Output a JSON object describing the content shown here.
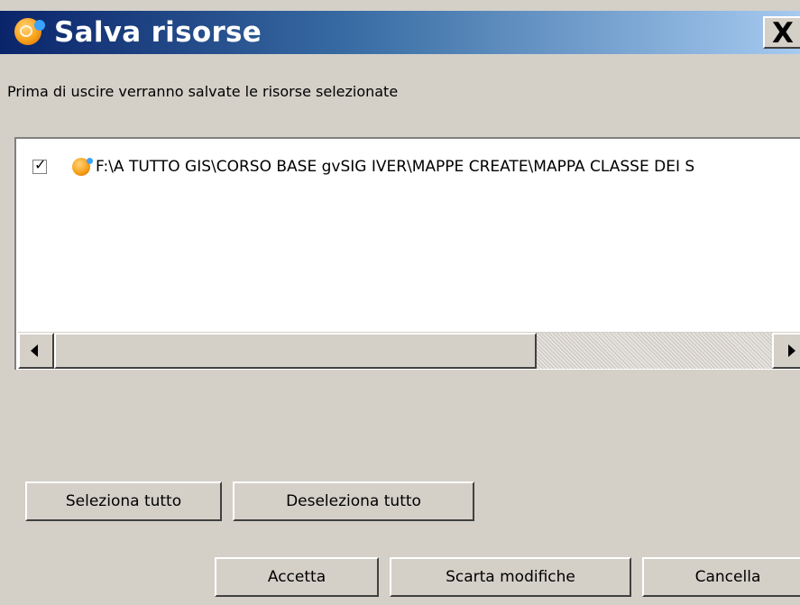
{
  "window": {
    "title": "Salva risorse",
    "close_label": "X"
  },
  "message": "Prima di uscire verranno salvate le risorse selezionate",
  "resources": [
    {
      "checked": true,
      "check_glyph": "✓",
      "icon": "gvsig-icon",
      "path": "F:\\A TUTTO GIS\\CORSO BASE gvSIG IVER\\MAPPE CREATE\\MAPPA CLASSE DEI S"
    }
  ],
  "scrollbar": {
    "left_icon": "arrow-left-icon",
    "right_icon": "arrow-right-icon"
  },
  "buttons": {
    "select_all": "Seleziona tutto",
    "deselect_all": "Deseleziona tutto",
    "accept": "Accetta",
    "discard": "Scarta modifiche",
    "cancel": "Cancella"
  },
  "colors": {
    "title_bar_start": "#0a246a",
    "title_bar_end": "#a6caf0",
    "dialog_bg": "#d4d0c8"
  }
}
